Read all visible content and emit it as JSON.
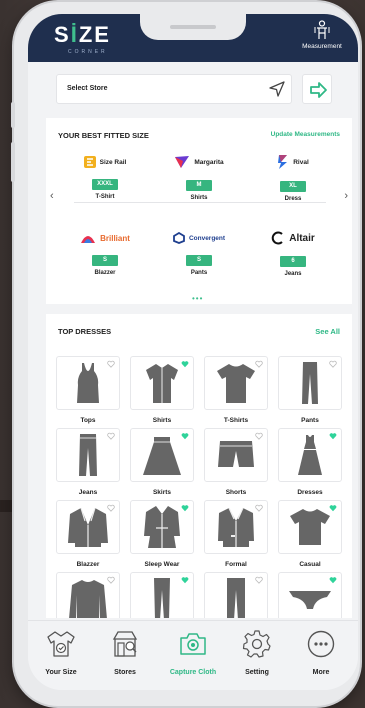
{
  "header": {
    "logo_text_1": "S",
    "logo_text_2": "ZE",
    "logo_sub": "CORNER",
    "measurement_label": "Measurement"
  },
  "store": {
    "placeholder": "Select Store"
  },
  "best_fit": {
    "title": "YOUR BEST FITTED SIZE",
    "link": "Update Measurements",
    "brands": [
      {
        "name": "Size Rail",
        "size": "XXXL",
        "category": "T-Shirt"
      },
      {
        "name": "Margarita",
        "size": "M",
        "category": "Shirts"
      },
      {
        "name": "Rival",
        "size": "XL",
        "category": "Dress"
      },
      {
        "name": "Brilliant",
        "size": "S",
        "category": "Blazzer"
      },
      {
        "name": "Convergent",
        "size": "S",
        "category": "Pants"
      },
      {
        "name": "Altair",
        "size": "6",
        "category": "Jeans"
      }
    ],
    "pager_dots": "•••"
  },
  "top_dresses": {
    "title": "TOP DRESSES",
    "link": "See All",
    "items": [
      {
        "label": "Tops",
        "icon": "tank-top-icon",
        "favorite": false
      },
      {
        "label": "Shirts",
        "icon": "shirt-icon",
        "favorite": true
      },
      {
        "label": "T-Shirts",
        "icon": "tshirt-icon",
        "favorite": false
      },
      {
        "label": "Pants",
        "icon": "pants-icon",
        "favorite": false
      },
      {
        "label": "Jeans",
        "icon": "jeans-icon",
        "favorite": false
      },
      {
        "label": "Skirts",
        "icon": "skirt-icon",
        "favorite": true
      },
      {
        "label": "Shorts",
        "icon": "shorts-icon",
        "favorite": false
      },
      {
        "label": "Dresses",
        "icon": "dress-icon",
        "favorite": true
      },
      {
        "label": "Blazzer",
        "icon": "blazer-icon",
        "favorite": false
      },
      {
        "label": "Sleep Wear",
        "icon": "robe-icon",
        "favorite": true
      },
      {
        "label": "Formal",
        "icon": "suit-icon",
        "favorite": false
      },
      {
        "label": "Casual",
        "icon": "casual-tee-icon",
        "favorite": true
      },
      {
        "label": "",
        "icon": "sweater-icon",
        "favorite": false
      },
      {
        "label": "",
        "icon": "leggings-icon",
        "favorite": true
      },
      {
        "label": "",
        "icon": "trousers-icon",
        "favorite": false
      },
      {
        "label": "",
        "icon": "underwear-icon",
        "favorite": true
      }
    ]
  },
  "nav": {
    "items": [
      {
        "label": "Your Size",
        "icon": "body-size-icon",
        "active": false
      },
      {
        "label": "Stores",
        "icon": "store-icon",
        "active": false
      },
      {
        "label": "Capture Cloth",
        "icon": "camera-icon",
        "active": true
      },
      {
        "label": "Setting",
        "icon": "gear-icon",
        "active": false
      },
      {
        "label": "More",
        "icon": "more-icon",
        "active": false
      }
    ]
  },
  "colors": {
    "header_bg": "#1f2f4e",
    "accent": "#36b57f",
    "badge": "#36b57f",
    "heart": "#2fd39a"
  }
}
